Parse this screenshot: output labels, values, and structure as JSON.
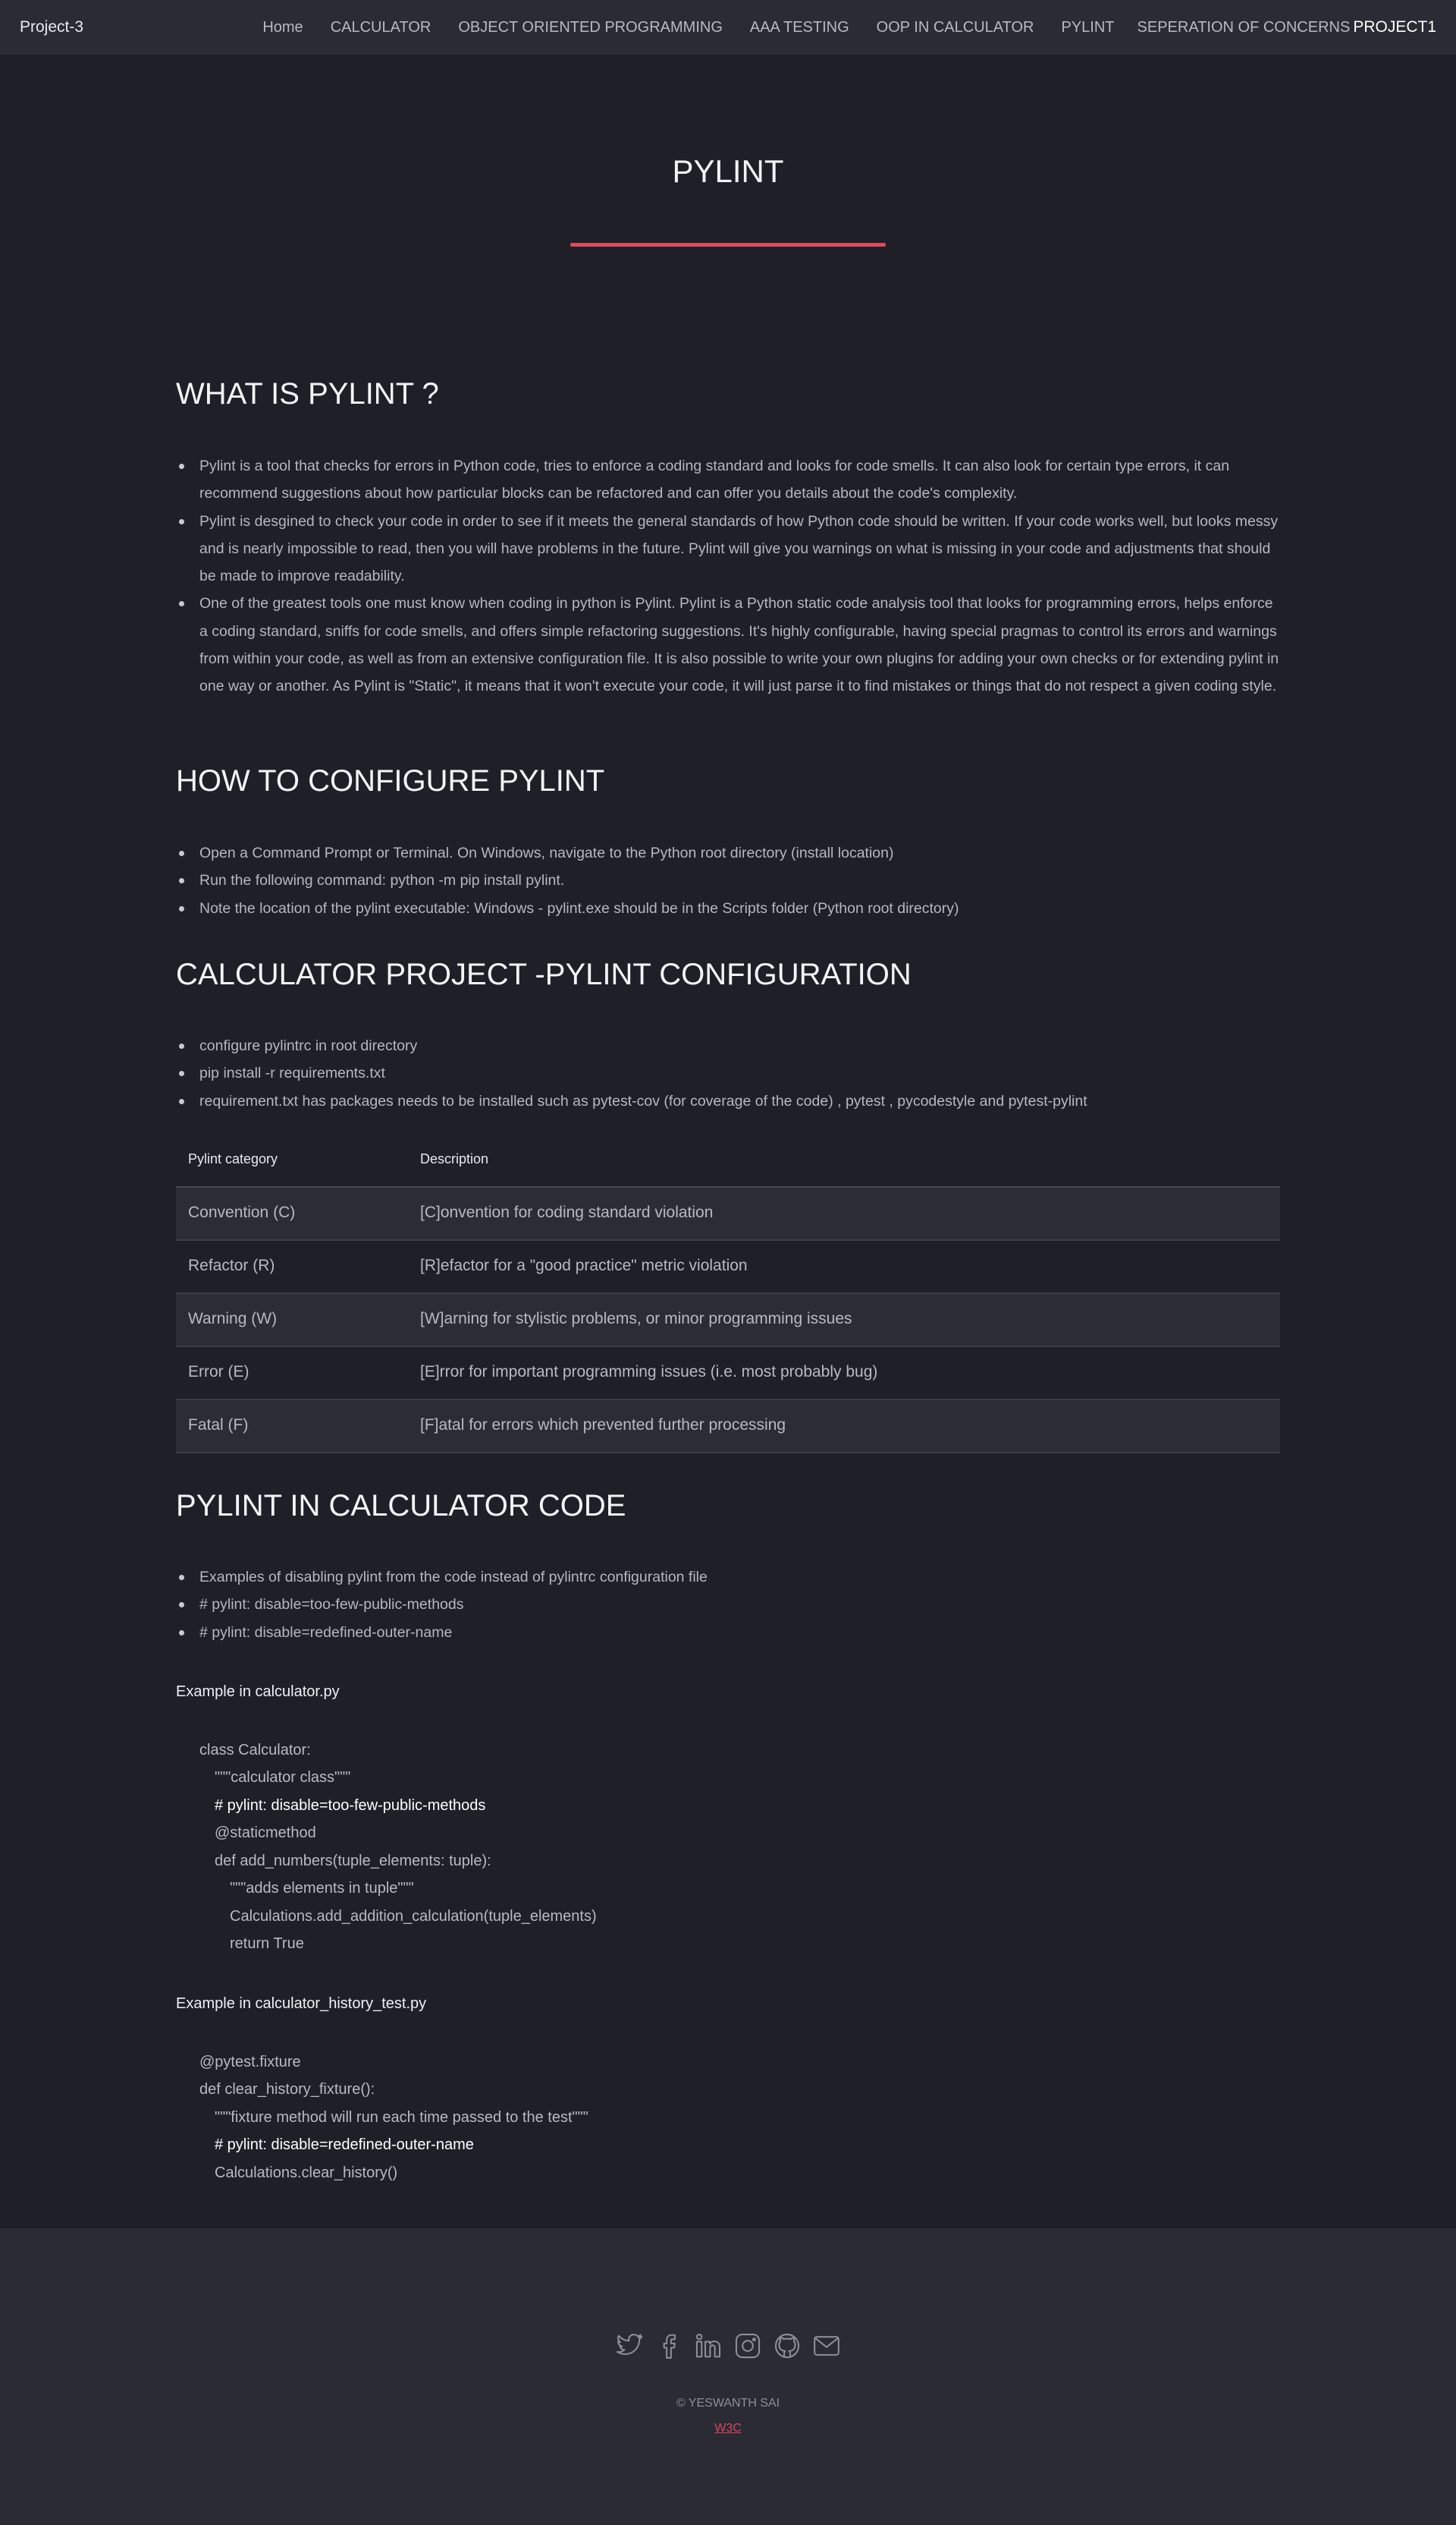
{
  "nav": {
    "brand": "Project-3",
    "items": [
      {
        "label": "Home"
      },
      {
        "label": "CALCULATOR"
      },
      {
        "label": "OBJECT ORIENTED PROGRAMMING"
      },
      {
        "label": "AAA TESTING"
      },
      {
        "label": "OOP IN CALCULATOR"
      },
      {
        "label": "PYLINT"
      },
      {
        "label": "SEPERATION OF CONCERNS"
      }
    ],
    "project_label": "PROJECT1"
  },
  "page_title": "PYLINT",
  "sections": [
    {
      "heading": "WHAT IS PYLINT ?",
      "bullets": [
        "Pylint is a tool that checks for errors in Python code, tries to enforce a coding standard and looks for code smells. It can also look for certain type errors, it can recommend suggestions about how particular blocks can be refactored and can offer you details about the code's complexity.",
        "Pylint is desgined to check your code in order to see if it meets the general standards of how Python code should be written. If your code works well, but looks messy and is nearly impossible to read, then you will have problems in the future. Pylint will give you warnings on what is missing in your code and adjustments that should be made to improve readability.",
        "One of the greatest tools one must know when coding in python is Pylint. Pylint is a Python static code analysis tool that looks for programming errors, helps enforce a coding standard, sniffs for code smells, and offers simple refactoring suggestions. It's highly configurable, having special pragmas to control its errors and warnings from within your code, as well as from an extensive configuration file. It is also possible to write your own plugins for adding your own checks or for extending pylint in one way or another. As Pylint is \"Static\", it means that it won't execute your code, it will just parse it to find mistakes or things that do not respect a given coding style."
      ]
    },
    {
      "heading": "HOW TO CONFIGURE PYLINT",
      "bullets": [
        "Open a Command Prompt or Terminal. On Windows, navigate to the Python root directory (install location)",
        "Run the following command: python -m pip install pylint.",
        "Note the location of the pylint executable: Windows - pylint.exe should be in the Scripts folder (Python root directory)"
      ]
    },
    {
      "heading": "CALCULATOR PROJECT -PYLINT CONFIGURATION",
      "bullets": [
        "configure pylintrc in root directory",
        "pip install -r requirements.txt",
        "requirement.txt has packages needs to be installed such as pytest-cov (for coverage of the code) , pytest , pycodestyle and pytest-pylint"
      ]
    },
    {
      "heading": "PYLINT IN CALCULATOR CODE",
      "bullets": [
        "Examples of disabling pylint from the code instead of pylintrc configuration file",
        "# pylint: disable=too-few-public-methods",
        "# pylint: disable=redefined-outer-name"
      ]
    }
  ],
  "table": {
    "headers": [
      "Pylint category",
      "Description"
    ],
    "rows": [
      [
        "Convention (C)",
        "[C]onvention for coding standard violation"
      ],
      [
        "Refactor (R)",
        "[R]efactor for a \"good practice\" metric violation"
      ],
      [
        "Warning (W)",
        "[W]arning for stylistic problems, or minor programming issues"
      ],
      [
        "Error (E)",
        "[E]rror for important programming issues (i.e. most probably bug)"
      ],
      [
        "Fatal (F)",
        "[F]atal for errors which prevented further processing"
      ]
    ]
  },
  "examples": [
    {
      "title": "Example in calculator.py",
      "lines": [
        "class Calculator:",
        "\"\"\"calculator class\"\"\"",
        "# pylint: disable=too-few-public-methods",
        "@staticmethod",
        "def add_numbers(tuple_elements: tuple):",
        "\"\"\"adds elements in tuple\"\"\"",
        "Calculations.add_addition_calculation(tuple_elements)",
        "return True"
      ]
    },
    {
      "title": "Example in calculator_history_test.py",
      "lines": [
        "@pytest.fixture",
        "def clear_history_fixture():",
        "\"\"\"fixture method will run each time passed to the test\"\"\"",
        "# pylint: disable=redefined-outer-name",
        "Calculations.clear_history()"
      ]
    }
  ],
  "footer": {
    "icons": [
      "twitter-icon",
      "facebook-icon",
      "linkedin-icon",
      "instagram-icon",
      "github-icon",
      "mail-icon"
    ],
    "copyright": "© YESWANTH SAI",
    "w3c_label": "W3C"
  },
  "colors": {
    "accent": "#e04a5c",
    "background": "#1f1f28",
    "header_footer": "#2b2b35"
  }
}
